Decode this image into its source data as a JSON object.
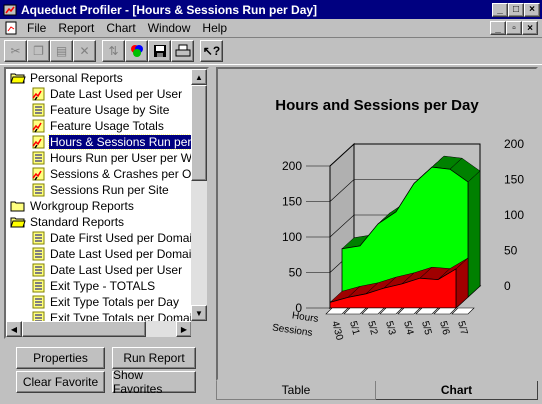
{
  "window": {
    "title": "Aqueduct Profiler - [Hours & Sessions Run per Day]"
  },
  "menu": [
    "File",
    "Report",
    "Chart",
    "Window",
    "Help"
  ],
  "tree": {
    "groups": [
      {
        "label": "Personal Reports",
        "items": [
          {
            "label": "Date Last Used per User",
            "icon": "report-chart-icon"
          },
          {
            "label": "Feature Usage by Site",
            "icon": "report-table-icon"
          },
          {
            "label": "Feature Usage Totals",
            "icon": "report-chart-icon"
          },
          {
            "label": "Hours & Sessions Run per Da",
            "icon": "report-chart-icon",
            "selected": true
          },
          {
            "label": "Hours Run per User per Wee",
            "icon": "report-table-icon"
          },
          {
            "label": "Sessions & Crashes per OS",
            "icon": "report-chart-icon"
          },
          {
            "label": "Sessions Run per Site",
            "icon": "report-table-icon"
          }
        ]
      },
      {
        "label": "Workgroup Reports",
        "items": []
      },
      {
        "label": "Standard Reports",
        "items": [
          {
            "label": "Date First Used per Domain",
            "icon": "report-table-icon"
          },
          {
            "label": "Date Last Used per Domain",
            "icon": "report-table-icon"
          },
          {
            "label": "Date Last Used per User",
            "icon": "report-table-icon"
          },
          {
            "label": "Exit Type - TOTALS",
            "icon": "report-table-icon"
          },
          {
            "label": "Exit Type Totals per Day",
            "icon": "report-table-icon"
          },
          {
            "label": "Exit Type Totals per Domain",
            "icon": "report-table-icon"
          }
        ]
      }
    ]
  },
  "buttons": {
    "properties": "Properties",
    "run_report": "Run Report",
    "clear_favorite": "Clear Favorite",
    "show_favorites": "Show Favorites"
  },
  "tabs": {
    "table": "Table",
    "chart": "Chart"
  },
  "chart_data": {
    "type": "area",
    "title": "Hours and Sessions per Day",
    "categories": [
      "4/30",
      "5/1",
      "5/2",
      "5/3",
      "5/4",
      "5/5",
      "5/6",
      "5/7"
    ],
    "series": [
      {
        "name": "Hours",
        "values": [
          68,
          72,
          103,
          120,
          160,
          183,
          180,
          162
        ],
        "color": "#00ff00"
      },
      {
        "name": "Sessions",
        "values": [
          8,
          15,
          20,
          28,
          34,
          42,
          40,
          55
        ],
        "color": "#ff0000"
      }
    ],
    "ylim": [
      0,
      200
    ],
    "yticks": [
      0,
      50,
      100,
      150,
      200
    ]
  },
  "colors": {
    "titlebar": "#000080",
    "selection": "#000080",
    "face": "#c0c0c0"
  }
}
